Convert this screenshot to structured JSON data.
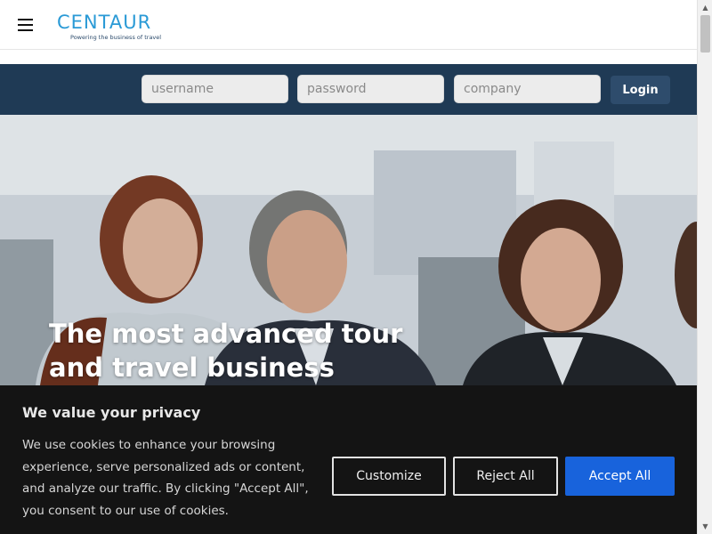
{
  "header": {
    "menu_icon": "hamburger-icon",
    "logo_text": "CENTAUR",
    "logo_tagline": "Powering the business of travel"
  },
  "login": {
    "username_placeholder": "username",
    "password_placeholder": "password",
    "company_placeholder": "company",
    "login_label": "Login"
  },
  "hero": {
    "title_line1": "The most advanced tour",
    "title_line2": "and travel business"
  },
  "cookie_banner": {
    "title": "We value your privacy",
    "text": "We use cookies to enhance your browsing experience, serve personalized ads or content, and analyze our traffic. By clicking \"Accept All\", you consent to our use of cookies.",
    "customize_label": "Customize",
    "reject_label": "Reject All",
    "accept_label": "Accept All",
    "accept_color": "#1863dc"
  },
  "colors": {
    "brand": "#2a9ad6",
    "login_bar": "#1f3a55",
    "login_button": "#2e4c6c",
    "banner_bg": "#141414"
  },
  "scrollbar": {
    "up_icon": "arrow-up-icon",
    "down_icon": "arrow-down-icon"
  }
}
